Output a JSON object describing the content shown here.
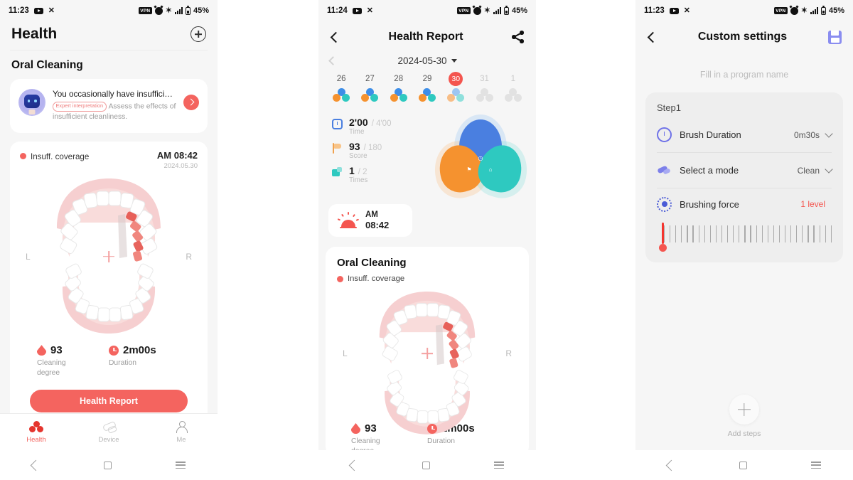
{
  "panels": {
    "health": {
      "status": {
        "time": "11:23",
        "battery": "45%",
        "icons": [
          "youtube-icon",
          "x-icon",
          "vpn-badge",
          "alarm-icon",
          "bluetooth-icon",
          "signal-icon",
          "battery-icon"
        ]
      },
      "title": "Health",
      "add_label": "+",
      "section_title": "Oral Cleaning",
      "tip": {
        "headline": "You occasionally have insufficient...",
        "badge": "Expert interpretation",
        "subtext": "Assess the effects of insufficient cleanliness."
      },
      "record": {
        "status_label": "Insuff. coverage",
        "time": "AM 08:42",
        "date": "2024.05.30",
        "left_label": "L",
        "right_label": "R"
      },
      "stats": [
        {
          "value": "93",
          "caption": "Cleaning degree",
          "icon": "drop-icon"
        },
        {
          "value": "2m00s",
          "caption": "Duration",
          "icon": "clock-icon"
        }
      ],
      "cta": "Health Report",
      "tabs": [
        {
          "label": "Health",
          "icon": "clover-icon",
          "active": true
        },
        {
          "label": "Device",
          "icon": "toothbrush-icon",
          "active": false
        },
        {
          "label": "Me",
          "icon": "person-icon",
          "active": false
        }
      ]
    },
    "report": {
      "status": {
        "time": "11:24",
        "battery": "45%"
      },
      "title": "Health Report",
      "date": "2024-05-30",
      "days": [
        {
          "num": "26",
          "state": "on"
        },
        {
          "num": "27",
          "state": "on"
        },
        {
          "num": "28",
          "state": "on"
        },
        {
          "num": "29",
          "state": "on"
        },
        {
          "num": "30",
          "state": "selected"
        },
        {
          "num": "31",
          "state": "off"
        },
        {
          "num": "1",
          "state": "off"
        }
      ],
      "metrics": [
        {
          "value": "2'00",
          "denominator": "/ 4'00",
          "caption": "Time",
          "icon": "alarm-icon"
        },
        {
          "value": "93",
          "denominator": "/ 180",
          "caption": "Score",
          "icon": "flag-icon"
        },
        {
          "value": "1",
          "denominator": "/ 2",
          "caption": "Times",
          "icon": "house-icon"
        }
      ],
      "session": {
        "ampm": "AM",
        "time": "08:42",
        "icon": "sunrise-icon"
      },
      "card": {
        "title": "Oral Cleaning",
        "legend": "Insuff. coverage",
        "left_label": "L",
        "right_label": "R"
      },
      "stats": [
        {
          "value": "93",
          "caption": "Cleaning degree"
        },
        {
          "value": "2m00s",
          "caption": "Duration"
        }
      ]
    },
    "settings": {
      "status": {
        "time": "11:23",
        "battery": "45%"
      },
      "title": "Custom settings",
      "save_icon": "save-icon",
      "program_placeholder": "Fill in a program name",
      "step_title": "Step1",
      "rows": [
        {
          "label": "Brush Duration",
          "value": "0m30s",
          "icon": "clock-icon"
        },
        {
          "label": "Select a mode",
          "value": "Clean",
          "icon": "brush-icon"
        },
        {
          "label": "Brushing force",
          "value": "1 level",
          "icon": "gear-icon"
        }
      ],
      "add_steps": "Add steps"
    }
  },
  "colors": {
    "accent_red": "#f4554f",
    "blue": "#4a7fe0",
    "orange": "#f5922f",
    "teal": "#2ec9c0",
    "purple": "#6f72e8"
  }
}
